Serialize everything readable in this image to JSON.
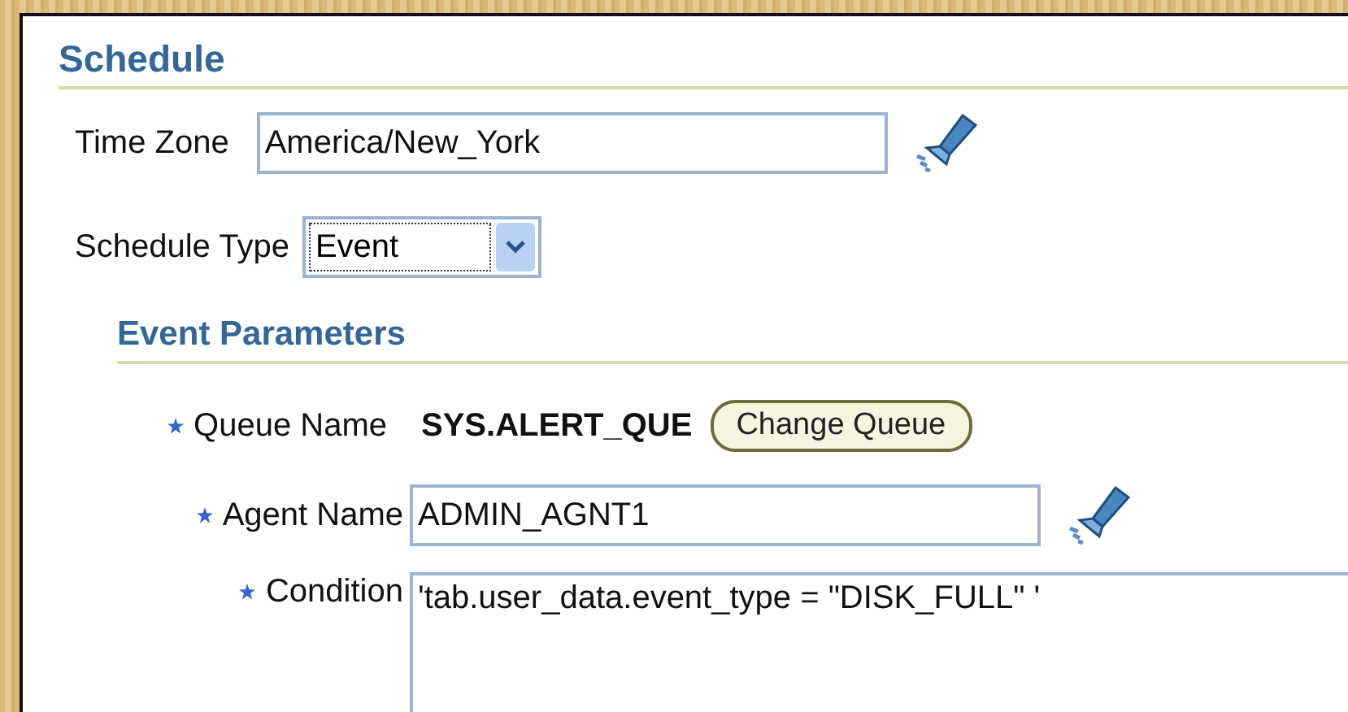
{
  "section": {
    "title": "Schedule"
  },
  "time_zone": {
    "label": "Time Zone",
    "value": "America/New_York"
  },
  "schedule_type": {
    "label": "Schedule Type",
    "value": "Event"
  },
  "event_parameters": {
    "title": "Event Parameters",
    "fields": [
      {
        "kind": "readonly",
        "label": "Queue Name",
        "required": true,
        "value": "SYS.ALERT_QUE",
        "button": "Change Queue"
      },
      {
        "kind": "lookup",
        "label": "Agent Name",
        "required": true,
        "value": "ADMIN_AGNT1"
      },
      {
        "kind": "textarea",
        "label": "Condition",
        "required": true,
        "value": "'tab.user_data.event_type = \"DISK_FULL\" '"
      }
    ]
  }
}
